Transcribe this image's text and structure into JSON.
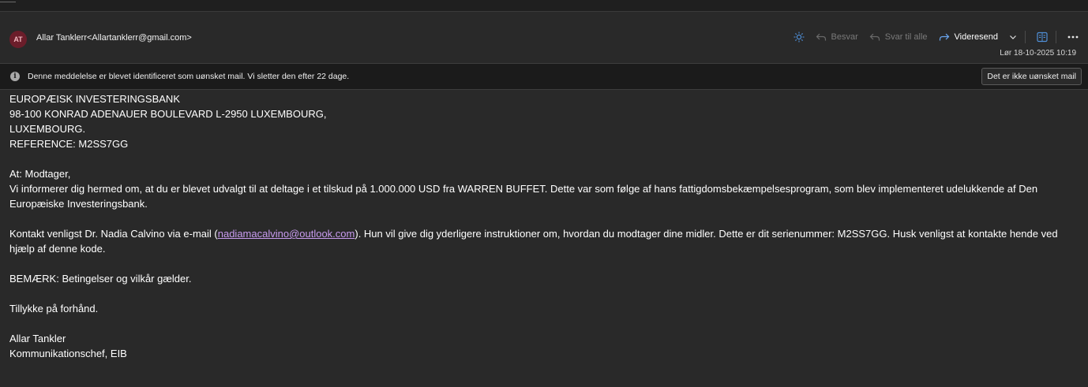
{
  "header": {
    "avatar_initials": "AT",
    "sender": "Allar Tanklerr<Allartanklerr@gmail.com>",
    "reply_label": "Besvar",
    "reply_all_label": "Svar til alle",
    "forward_label": "Videresend",
    "datetime": "Lør 18-10-2025 10:19"
  },
  "junk_banner": {
    "message": "Denne meddelelse er blevet identificeret som uønsket mail. Vi sletter den efter 22 dage.",
    "button_label": "Det er ikke uønsket mail"
  },
  "body": {
    "address_lines": [
      "EUROPÆISK INVESTERINGSBANK",
      "98-100 KONRAD ADENAUER BOULEVARD L-2950 LUXEMBOURG,",
      "LUXEMBOURG.",
      "REFERENCE: M2SS7GG"
    ],
    "greeting": "At: Modtager,",
    "paragraph1": "Vi informerer dig hermed om, at du er blevet udvalgt til at deltage i et tilskud på 1.000.000 USD fra WARREN BUFFET. Dette var som følge af hans fattigdomsbekæmpelsesprogram, som blev implementeret udelukkende af Den Europæiske Investeringsbank.",
    "paragraph2_before": "Kontakt venligst Dr. Nadia Calvino via e-mail (",
    "email_link": "nadiamacalvino@outlook.com",
    "paragraph2_after": "). Hun vil give dig yderligere instruktioner om, hvordan du modtager dine midler. Dette er dit serienummer: M2SS7GG. Husk venligst at kontakte hende ved hjælp af denne kode.",
    "note": "BEMÆRK: Betingelser og vilkår gælder.",
    "congrats": "Tillykke på forhånd.",
    "signature_name": "Allar Tankler",
    "signature_title": "Kommunikationschef, EIB"
  },
  "colors": {
    "background": "#292929",
    "banner": "#1b1b1b",
    "avatar": "#6b1d2a",
    "link": "#c99cf0",
    "accent_icon": "#4f8fd8"
  },
  "icons": [
    "sun-icon",
    "reply-icon",
    "reply-all-icon",
    "forward-icon",
    "chevron-down-icon",
    "immersive-reader-icon",
    "more-icon",
    "info-icon"
  ]
}
